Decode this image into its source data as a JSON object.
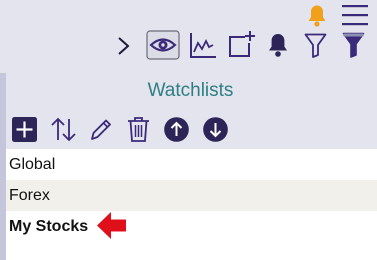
{
  "toolbar": {
    "icons": [
      {
        "name": "play-icon",
        "color": "#1f1a3d"
      },
      {
        "name": "eye-icon",
        "color": "#3b2a7a",
        "state": "active"
      },
      {
        "name": "chart-line-icon",
        "color": "#3b2a7a"
      },
      {
        "name": "add-window-icon",
        "color": "#3b2a7a"
      },
      {
        "name": "bell-icon",
        "color": "#2d2457"
      },
      {
        "name": "filter-outline-icon",
        "color": "#3b2a7a"
      },
      {
        "name": "filter-filled-icon",
        "color": "#3b2a7a"
      },
      {
        "name": "alert-bell-icon",
        "color": "#f0a01a"
      },
      {
        "name": "hamburger-menu-icon",
        "color": "#3b2a7a"
      }
    ]
  },
  "watchlists": {
    "title": "Watchlists",
    "actions": [
      {
        "name": "add-icon"
      },
      {
        "name": "sort-icon"
      },
      {
        "name": "edit-icon"
      },
      {
        "name": "delete-icon"
      },
      {
        "name": "move-up-icon"
      },
      {
        "name": "move-down-icon"
      }
    ],
    "items": [
      {
        "label": "Global"
      },
      {
        "label": "Forex"
      },
      {
        "label": "My Stocks"
      }
    ]
  },
  "colors": {
    "accent": "#2e7e83",
    "icon": "#3b2a7a",
    "annotation_arrow": "#e0101b",
    "notification": "#f0a01a"
  }
}
